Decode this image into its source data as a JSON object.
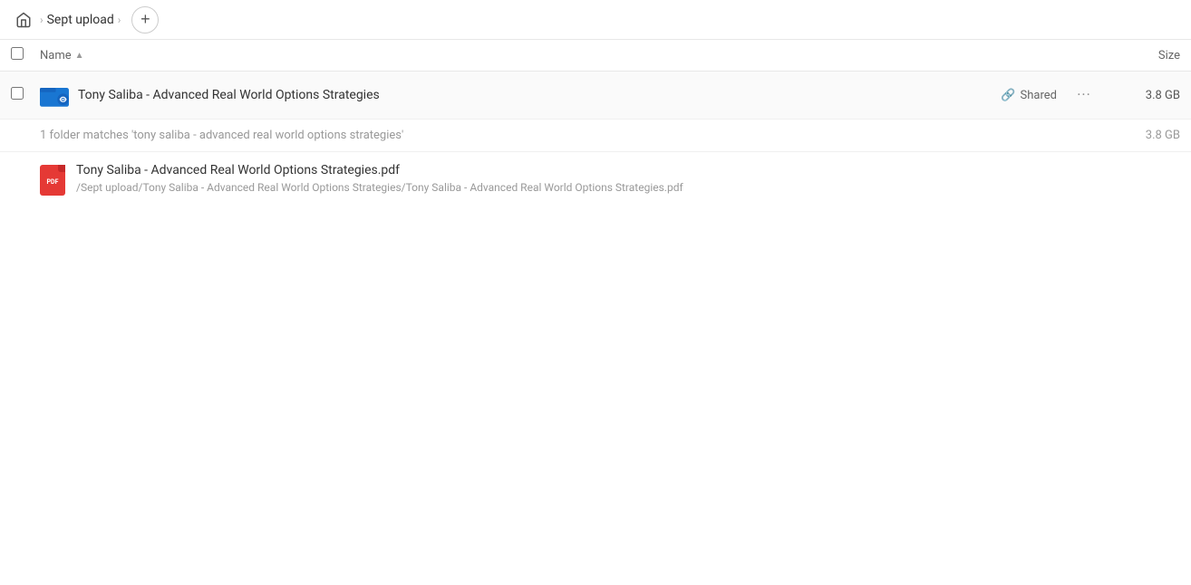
{
  "breadcrumb": {
    "home_label": "Home",
    "separator": "›",
    "folder_name": "Sept upload",
    "add_button_label": "+"
  },
  "columns": {
    "name_label": "Name",
    "size_label": "Size",
    "sort_indicator": "▲"
  },
  "folder_row": {
    "name": "Tony Saliba - Advanced Real World Options Strategies",
    "shared_label": "Shared",
    "size": "3.8 GB",
    "more_icon": "•••"
  },
  "search_info": {
    "text": "1 folder matches 'tony saliba - advanced real world options strategies'",
    "size": "3.8 GB"
  },
  "pdf_result": {
    "filename": "Tony Saliba - Advanced Real World Options Strategies.pdf",
    "path": "/Sept upload/Tony Saliba - Advanced Real World Options Strategies/Tony Saliba - Advanced Real World Options Strategies.pdf",
    "type_label": "PDF"
  }
}
